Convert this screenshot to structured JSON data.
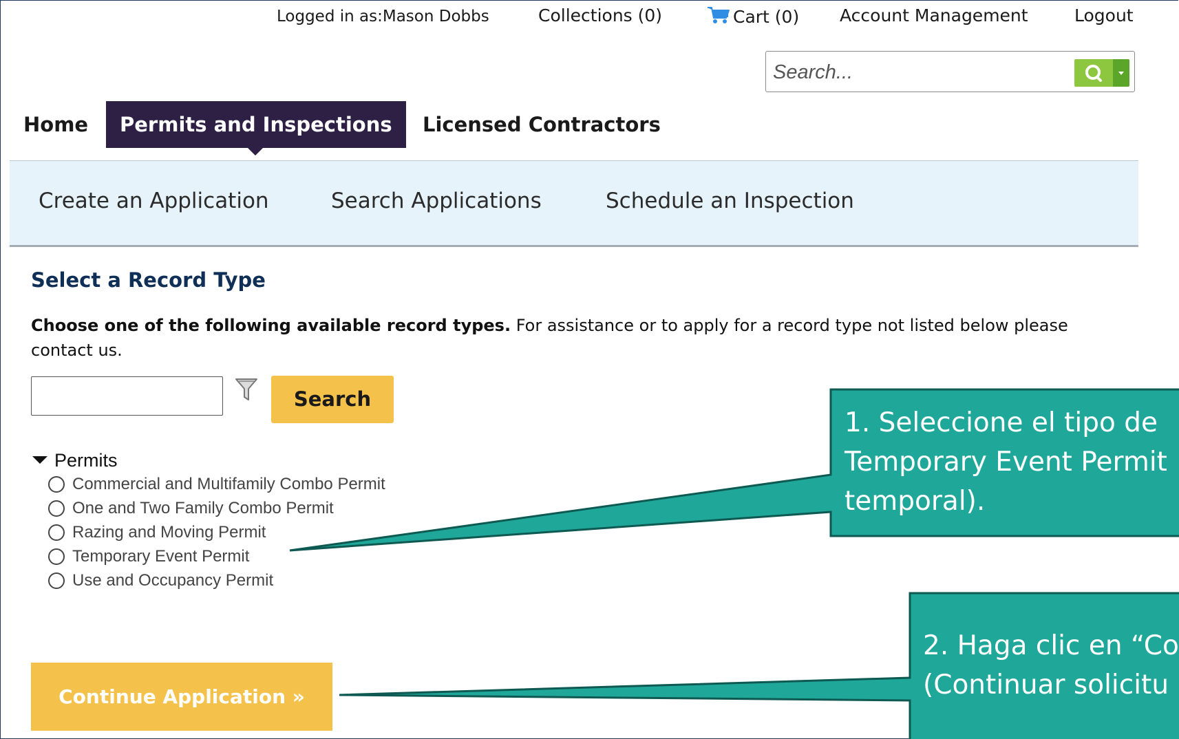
{
  "header": {
    "logged_in": "Logged in as:Mason Dobbs",
    "collections": "Collections (0)",
    "cart": "Cart (0)",
    "account": "Account Management",
    "logout": "Logout",
    "search_placeholder": "Search..."
  },
  "nav": {
    "tabs": [
      {
        "label": "Home"
      },
      {
        "label": "Permits and Inspections",
        "active": true
      },
      {
        "label": "Licensed Contractors"
      }
    ],
    "sub": [
      {
        "label": "Create an Application"
      },
      {
        "label": "Search Applications"
      },
      {
        "label": "Schedule an Inspection"
      }
    ]
  },
  "content": {
    "title": "Select a Record Type",
    "intro_bold": "Choose one of the following available record types.",
    "intro_rest": " For assistance or to apply for a record type not listed below please contact us.",
    "filter_value": "",
    "search_label": "Search",
    "group_label": "Permits",
    "options": [
      {
        "label": "Commercial and Multifamily Combo Permit"
      },
      {
        "label": "One and Two Family Combo Permit"
      },
      {
        "label": "Razing and Moving Permit"
      },
      {
        "label": "Temporary Event Permit"
      },
      {
        "label": "Use and Occupancy Permit"
      }
    ],
    "continue_label": "Continue Application »"
  },
  "callouts": {
    "one": {
      "line1": "1. Seleccione el tipo de",
      "line2": "Temporary Event Permit",
      "line3": "temporal)."
    },
    "two": {
      "line1": "2. Haga clic en “Co",
      "line2": "(Continuar solicitu"
    }
  },
  "colors": {
    "nav_active": "#2e1f45",
    "accent_yellow": "#f4c14a",
    "callout_fill": "#1fa89a",
    "subnav_bg": "#e6f3fb",
    "title_blue": "#0f2f57",
    "search_green": "#8dc63f"
  },
  "icons": [
    "cart-icon",
    "search-icon",
    "chevron-down-icon",
    "filter-icon",
    "triangle-down-icon",
    "radio-icon"
  ]
}
